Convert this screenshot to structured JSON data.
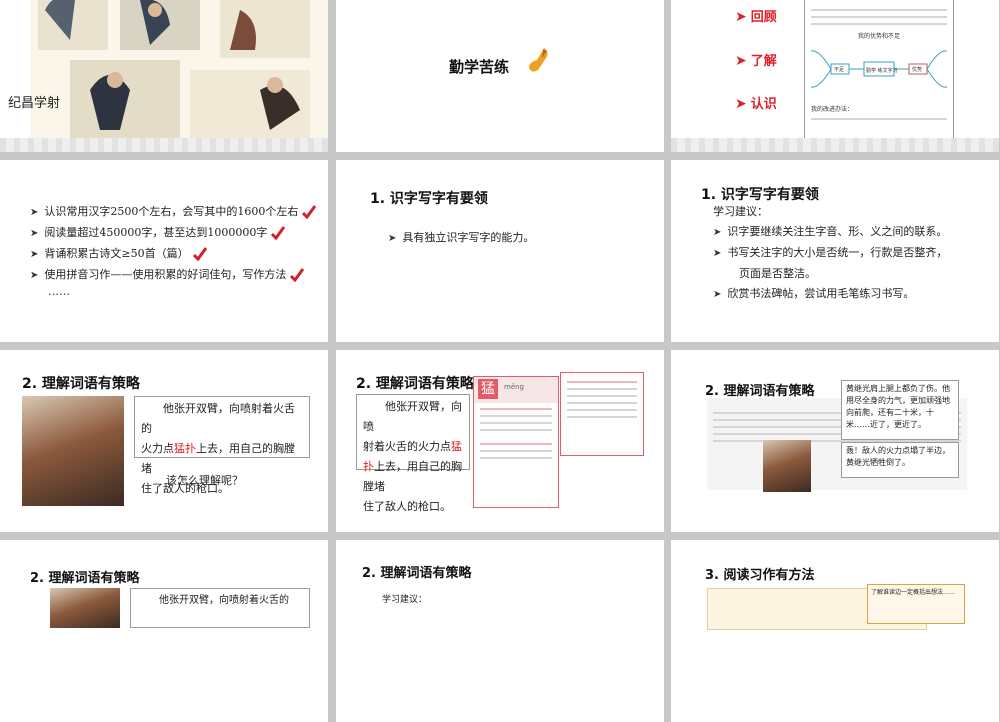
{
  "s1": {
    "caption": "纪昌学射"
  },
  "s2": {
    "title": "勤学苦练"
  },
  "s3": {
    "items": [
      "回顾",
      "了解",
      "认识"
    ],
    "tiny_heading": "我的优势和不足",
    "tiny_footer": "我的改进办法：",
    "tiny_mid": "勤学 练文字习",
    "tiny_left": "不足",
    "tiny_right": "优势"
  },
  "s4": {
    "items": [
      "认识常用汉字2500个左右，会写其中的1600个左右",
      "阅读量超过450000字，甚至达到1000000字",
      "背诵积累古诗文≥50首（篇）",
      "使用拼音习作——使用积累的好词佳句，写作方法"
    ],
    "ellipsis": "……"
  },
  "s5": {
    "title": "1. 识字写字有要领",
    "item": "具有独立识字写字的能力。"
  },
  "s6": {
    "title": "1. 识字写字有要领",
    "sub": "学习建议：",
    "items": [
      "识字要继续关注生字音、形、义之间的联系。",
      "书写关注字的大小是否统一，行款是否整齐，"
    ],
    "cont": "页面是否整洁。",
    "item3": "欣赏书法碑帖，尝试用毛笔练习书写。"
  },
  "s7": {
    "title": "2. 理解词语有策略",
    "passage_a": "他张开双臂，向喷射着火舌的",
    "passage_b": "火力点",
    "passage_hl": "猛扑",
    "passage_c": "上去，用自己的胸膛堵",
    "passage_d": "住了敌人的枪口。",
    "question": "该怎么理解呢？"
  },
  "s8": {
    "title": "2. 理解词语有策略",
    "passage_a": "他张开双臂，向喷",
    "passage_b": "射着火舌的火力点",
    "passage_hl": "猛扑",
    "passage_c": "上去，用自己的胸膛堵",
    "passage_d": "住了敌人的枪口。",
    "dict_char": "猛",
    "dict_pinyin": "měng"
  },
  "s9": {
    "title": "2. 理解词语有策略",
    "bubble1": "黄继光肩上腿上都负了伤。他用尽全身的力气，更加顽强地向前爬，还有二十米，十米……近了，更近了。",
    "bubble2": "轰！敌人的火力点塌了半边，黄继光牺牲倒了。"
  },
  "s10": {
    "title": "2. 理解词语有策略",
    "passage": "他张开双臂，向喷射着火舌的"
  },
  "s11": {
    "title": "2. 理解词语有策略",
    "sub": "学习建议："
  },
  "s12": {
    "title": "3. 阅读习作有方法",
    "note": "了解谁读边一定概括出想法……"
  },
  "colors": {
    "accent_red": "#e0202a",
    "card_red": "#e35b66"
  }
}
